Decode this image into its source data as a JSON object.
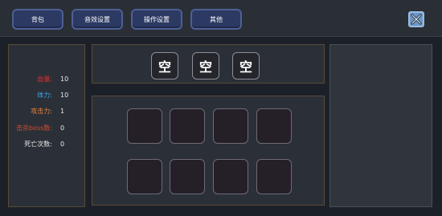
{
  "tabs": [
    {
      "label": "背包"
    },
    {
      "label": "音效设置"
    },
    {
      "label": "操作设置"
    },
    {
      "label": "其他"
    }
  ],
  "stats": [
    {
      "label": "血量:",
      "value": "10",
      "color": "#e03030"
    },
    {
      "label": "体力:",
      "value": "10",
      "color": "#38a8e8"
    },
    {
      "label": "攻击力:",
      "value": "1",
      "color": "#e8803a"
    },
    {
      "label": "击杀boss数:",
      "value": "0",
      "color": "#d84a2a"
    },
    {
      "label": "死亡次数:",
      "value": "0",
      "color": "#e8e8e8"
    }
  ],
  "equip_slots": [
    {
      "label": "空"
    },
    {
      "label": "空"
    },
    {
      "label": "空"
    }
  ],
  "inventory_slot_count": 8,
  "colors": {
    "tab_bg": "#2c3a63",
    "close_bg": "#6b97c8",
    "panel_border": "#5a4a36"
  }
}
